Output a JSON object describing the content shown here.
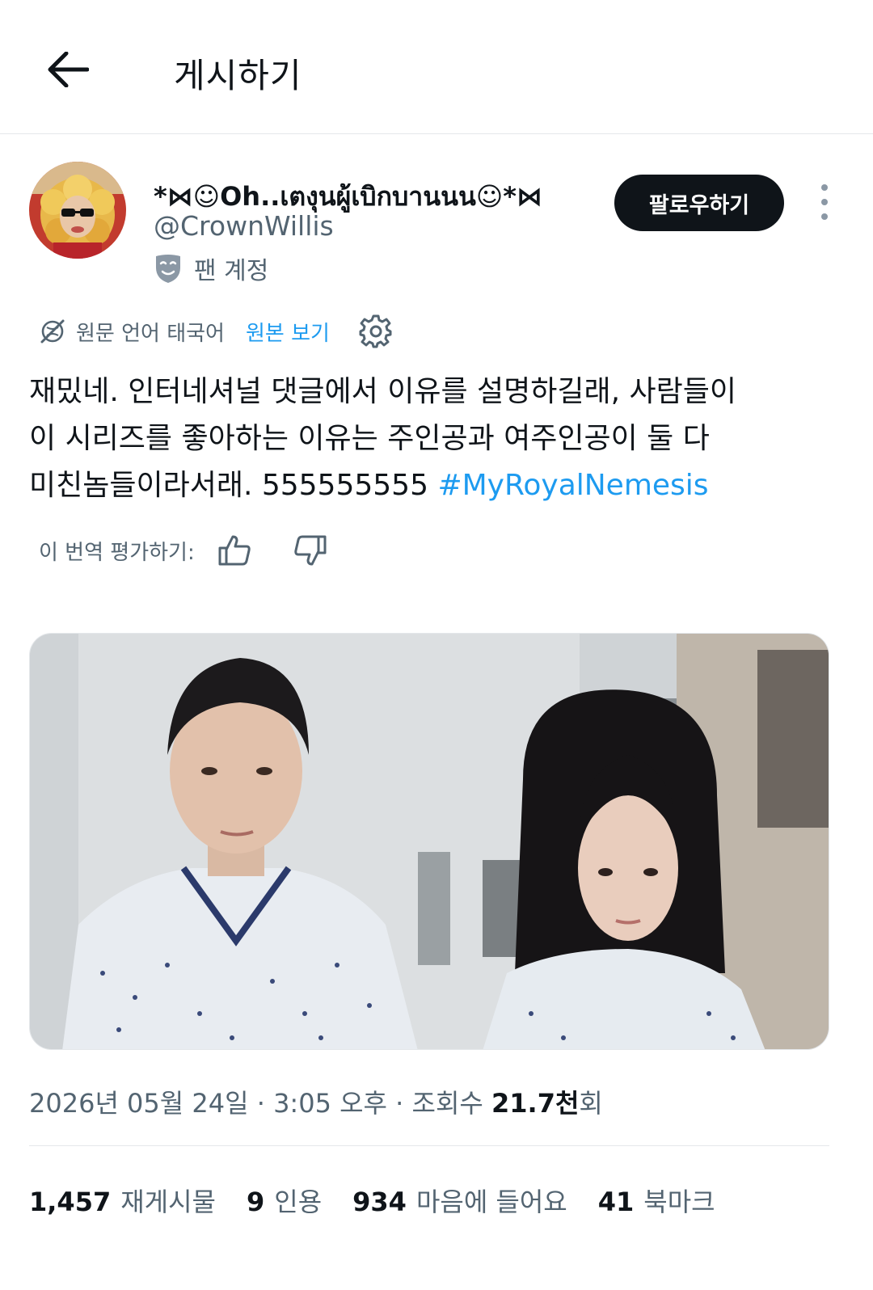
{
  "header": {
    "title": "게시하기"
  },
  "author": {
    "display_name": "*⋈☺Oh..เตงุนผู้เบิกบานนน☺*⋈",
    "handle": "@CrownWillis",
    "badge_label": "팬 계정",
    "follow_label": "팔로우하기"
  },
  "translation": {
    "source_language": "원문 언어 태국어",
    "show_original": "원본 보기",
    "rate_label": "이 번역 평가하기:"
  },
  "tweet": {
    "line1": "재밌네. 인터네셔널 댓글에서 이유를 설명하길래, 사람들이",
    "line2": "이 시리즈를 좋아하는 이유는 주인공과 여주인공이 둘 다",
    "line3": "미친놈들이라서래. 555555555 ",
    "hashtag": "#MyRoyalNemesis"
  },
  "meta": {
    "date": "2026년 05월 24일",
    "sep1": " · ",
    "time": "3:05 오후",
    "sep2": " · ",
    "views_label": "조회수 ",
    "views_value": "21.7천",
    "views_suffix": "회"
  },
  "stats": {
    "reposts_count": "1,457",
    "reposts_label": "재게시물",
    "quotes_count": "9",
    "quotes_label": "인용",
    "likes_count": "934",
    "likes_label": "마음에 들어요",
    "bookmarks_count": "41",
    "bookmarks_label": "북마크"
  },
  "colors": {
    "accent": "#1d9bf0",
    "text_primary": "#0f1419",
    "text_secondary": "#536471",
    "divider": "#e4e7ea"
  },
  "icons": {
    "back": "arrow-left-icon",
    "badge": "mask-icon",
    "translate": "globe-slash-icon",
    "settings": "gear-icon",
    "more": "more-vertical-icon",
    "like_translation": "thumbs-up-icon",
    "dislike_translation": "thumbs-down-icon"
  }
}
